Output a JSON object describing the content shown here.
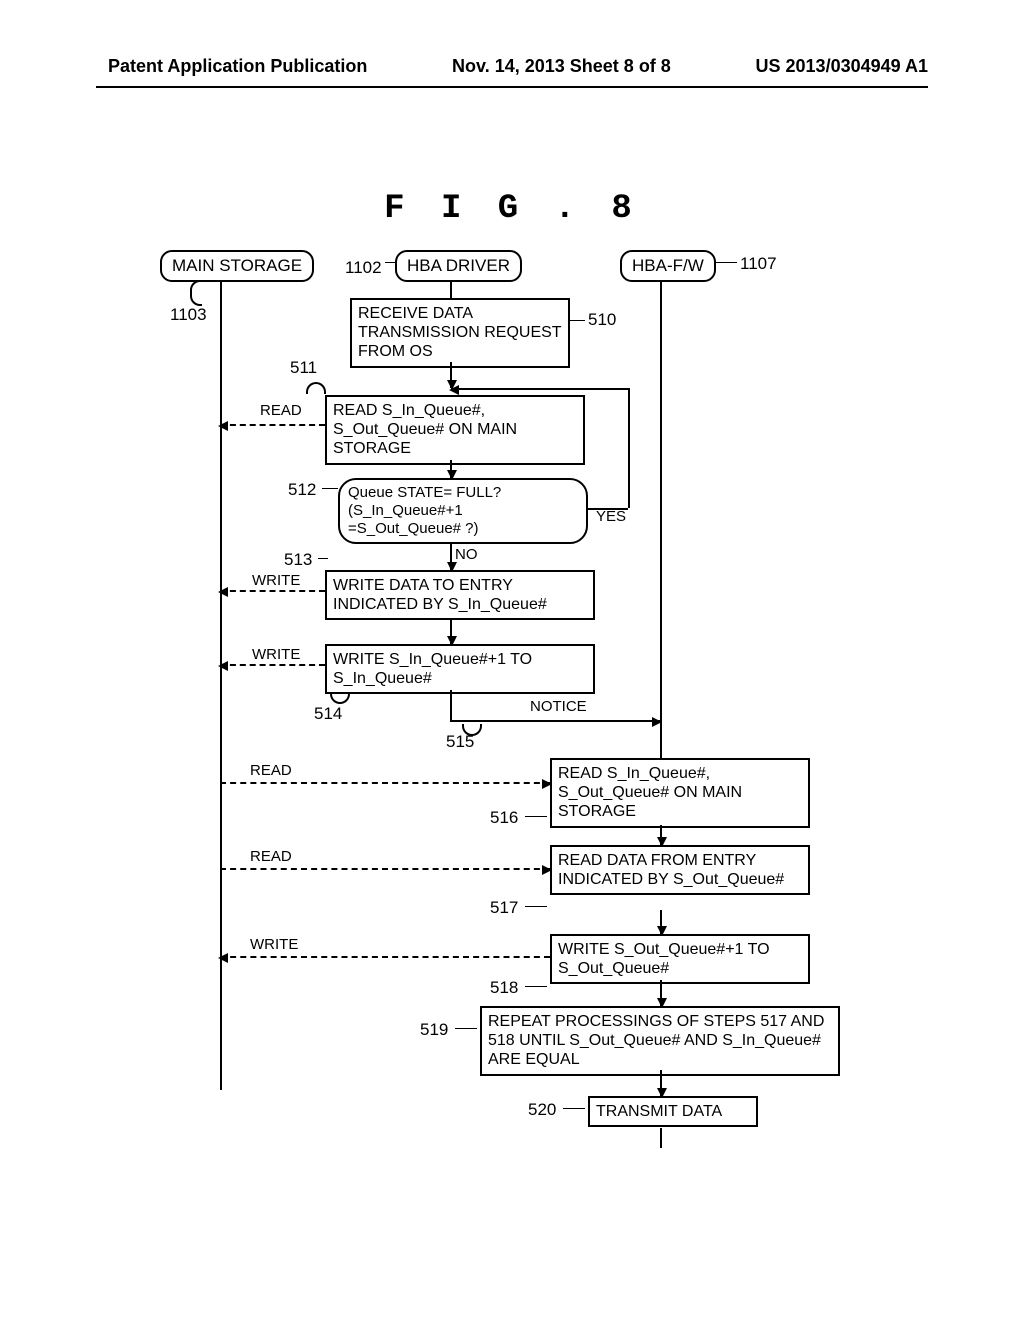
{
  "header": {
    "left": "Patent Application Publication",
    "center": "Nov. 14, 2013  Sheet 8 of 8",
    "right": "US 2013/0304949 A1"
  },
  "figure": {
    "title": "F I G . 8"
  },
  "lanes": {
    "main_storage": {
      "label": "MAIN STORAGE",
      "ref": "1103"
    },
    "hba_driver": {
      "label": "HBA DRIVER",
      "ref": "1102"
    },
    "hba_fw": {
      "label": "HBA-F/W",
      "ref": "1107"
    }
  },
  "steps": {
    "s510": {
      "ref": "510",
      "text": "RECEIVE DATA TRANSMISSION REQUEST FROM OS"
    },
    "s511": {
      "ref": "511",
      "text": "READ S_In_Queue#, S_Out_Queue# ON MAIN STORAGE",
      "op": "READ"
    },
    "s512": {
      "ref": "512",
      "text": "Queue STATE= FULL? (S_In_Queue#+1               =S_Out_Queue# ?)",
      "yes": "YES",
      "no": "NO"
    },
    "s513": {
      "ref": "513",
      "text": "WRITE DATA TO ENTRY INDICATED BY S_In_Queue#",
      "op": "WRITE"
    },
    "s514": {
      "ref": "514",
      "text": "WRITE S_In_Queue#+1 TO S_In_Queue#",
      "op": "WRITE"
    },
    "s515": {
      "ref": "515",
      "text": "NOTICE"
    },
    "s516": {
      "ref": "516",
      "text": "READ S_In_Queue#, S_Out_Queue# ON MAIN STORAGE",
      "op": "READ"
    },
    "s517": {
      "ref": "517",
      "text": "READ DATA FROM ENTRY INDICATED BY S_Out_Queue#",
      "op": "READ"
    },
    "s518": {
      "ref": "518",
      "text": "WRITE S_Out_Queue#+1 TO S_Out_Queue#",
      "op": "WRITE"
    },
    "s519": {
      "ref": "519",
      "text": "REPEAT PROCESSINGS OF STEPS 517 AND 518 UNTIL S_Out_Queue# AND S_In_Queue# ARE EQUAL"
    },
    "s520": {
      "ref": "520",
      "text": "TRANSMIT DATA"
    }
  },
  "chart_data": {
    "type": "diagram-flowchart-sequence",
    "title": "FIG.8",
    "lanes": [
      "MAIN STORAGE (1103)",
      "HBA DRIVER (1102)",
      "HBA-F/W (1107)"
    ],
    "nodes": [
      {
        "id": "510",
        "lane": "HBA DRIVER",
        "shape": "process",
        "text": "RECEIVE DATA TRANSMISSION REQUEST FROM OS"
      },
      {
        "id": "511",
        "lane": "HBA DRIVER",
        "shape": "process",
        "text": "READ S_In_Queue#, S_Out_Queue# ON MAIN STORAGE"
      },
      {
        "id": "512",
        "lane": "HBA DRIVER",
        "shape": "decision",
        "text": "Queue STATE= FULL? (S_In_Queue#+1 = S_Out_Queue# ?)"
      },
      {
        "id": "513",
        "lane": "HBA DRIVER",
        "shape": "process",
        "text": "WRITE DATA TO ENTRY INDICATED BY S_In_Queue#"
      },
      {
        "id": "514",
        "lane": "HBA DRIVER",
        "shape": "process",
        "text": "WRITE S_In_Queue#+1 TO S_In_Queue#"
      },
      {
        "id": "515",
        "lane": "HBA DRIVER→HBA-F/W",
        "shape": "message",
        "text": "NOTICE"
      },
      {
        "id": "516",
        "lane": "HBA-F/W",
        "shape": "process",
        "text": "READ S_In_Queue#, S_Out_Queue# ON MAIN STORAGE"
      },
      {
        "id": "517",
        "lane": "HBA-F/W",
        "shape": "process",
        "text": "READ DATA FROM ENTRY INDICATED BY S_Out_Queue#"
      },
      {
        "id": "518",
        "lane": "HBA-F/W",
        "shape": "process",
        "text": "WRITE S_Out_Queue#+1 TO S_Out_Queue#"
      },
      {
        "id": "519",
        "lane": "HBA-F/W",
        "shape": "process",
        "text": "REPEAT PROCESSINGS OF STEPS 517 AND 518 UNTIL S_Out_Queue# AND S_In_Queue# ARE EQUAL"
      },
      {
        "id": "520",
        "lane": "HBA-F/W",
        "shape": "process",
        "text": "TRANSMIT DATA"
      }
    ],
    "edges": [
      {
        "from": "510",
        "to": "511"
      },
      {
        "from": "511",
        "to": "512"
      },
      {
        "from": "512",
        "to": "511",
        "label": "YES"
      },
      {
        "from": "512",
        "to": "513",
        "label": "NO"
      },
      {
        "from": "513",
        "to": "514"
      },
      {
        "from": "514",
        "to": "515"
      },
      {
        "from": "515",
        "to": "516"
      },
      {
        "from": "516",
        "to": "517"
      },
      {
        "from": "517",
        "to": "518"
      },
      {
        "from": "518",
        "to": "519"
      },
      {
        "from": "519",
        "to": "520"
      },
      {
        "from": "511",
        "to": "MAIN STORAGE",
        "style": "dashed",
        "label": "READ"
      },
      {
        "from": "513",
        "to": "MAIN STORAGE",
        "style": "dashed",
        "label": "WRITE"
      },
      {
        "from": "514",
        "to": "MAIN STORAGE",
        "style": "dashed",
        "label": "WRITE"
      },
      {
        "from": "MAIN STORAGE",
        "to": "516",
        "style": "dashed",
        "label": "READ"
      },
      {
        "from": "MAIN STORAGE",
        "to": "517",
        "style": "dashed",
        "label": "READ"
      },
      {
        "from": "518",
        "to": "MAIN STORAGE",
        "style": "dashed",
        "label": "WRITE"
      }
    ]
  }
}
